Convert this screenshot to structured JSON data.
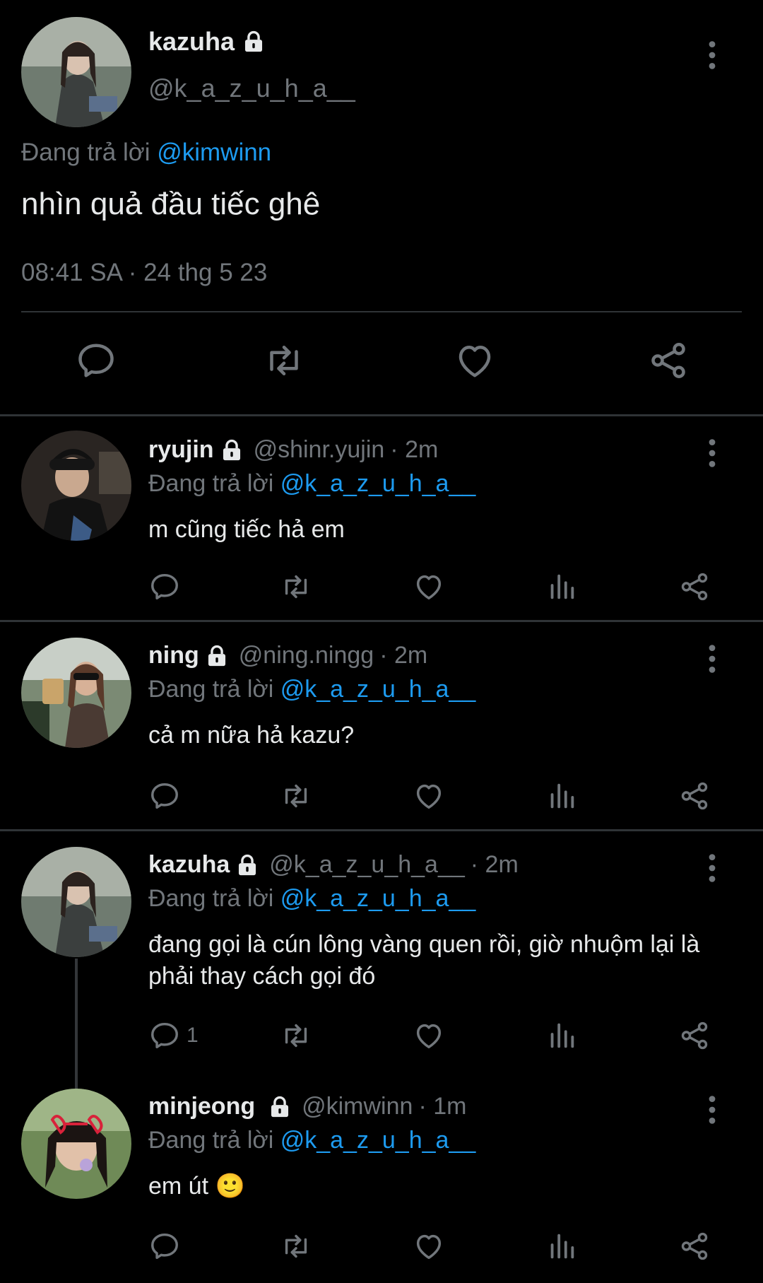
{
  "main_tweet": {
    "display_name": "kazuha",
    "handle": "@k_a_z_u_h_a__",
    "replying_prefix": "Đang trả lời",
    "replying_to": "@kimwinn",
    "text": "nhìn quả đầu tiếc ghê",
    "timestamp": "08:41 SA · 24 thg 5 23"
  },
  "replies": [
    {
      "display_name": "ryujin",
      "handle": "@shinr.yujin",
      "time": "· 2m",
      "replying_prefix": "Đang trả lời",
      "replying_to": "@k_a_z_u_h_a__",
      "text": "m cũng tiếc hả em",
      "reply_count": ""
    },
    {
      "display_name": "ning",
      "handle": "@ning.ningg",
      "time": "· 2m",
      "replying_prefix": "Đang trả lời",
      "replying_to": "@k_a_z_u_h_a__",
      "text": "cả m nữa hả kazu?",
      "reply_count": ""
    },
    {
      "display_name": "kazuha",
      "handle": "@k_a_z_u_h_a__",
      "time": "· 2m",
      "replying_prefix": "Đang trả lời",
      "replying_to": "@k_a_z_u_h_a__",
      "text": "đang gọi là cún lông vàng quen rồi, giờ nhuộm lại là phải thay cách gọi đó",
      "reply_count": "1"
    },
    {
      "display_name": "minjeong",
      "handle": "@kimwinn",
      "time": "· 1m",
      "replying_prefix": "Đang trả lời",
      "replying_to": "@k_a_z_u_h_a__",
      "text": "em út 🙂",
      "reply_count": ""
    }
  ],
  "icons": {
    "reply": "reply-icon",
    "retweet": "retweet-icon",
    "like": "like-icon",
    "views": "views-icon",
    "share": "share-icon",
    "more": "more-vertical-icon",
    "lock": "lock-icon"
  },
  "colors": {
    "background": "#000000",
    "text": "#e7e9ea",
    "secondary": "#71767b",
    "link": "#1d9bf0",
    "divider": "#2f3336"
  }
}
